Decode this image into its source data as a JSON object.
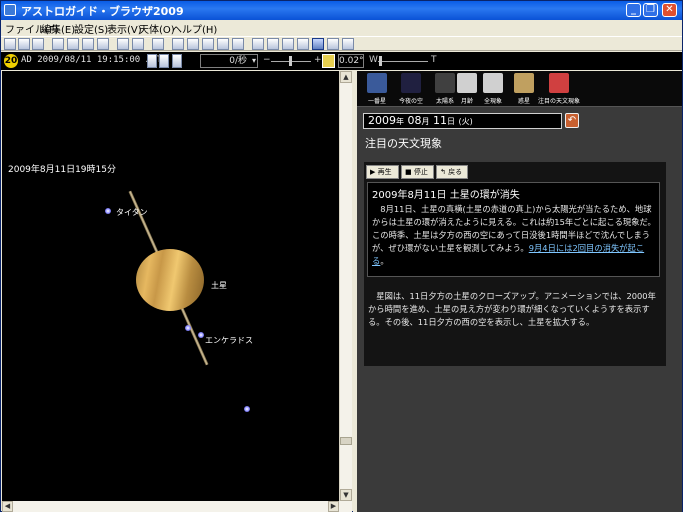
{
  "window": {
    "title": "アストロガイド・ブラウザ2009",
    "controls": [
      "_",
      "❐",
      "✕"
    ]
  },
  "menu": [
    "ファイル(F)",
    "編集(E)",
    "設定(S)",
    "表示(V)",
    "天体(O)",
    "ヘルプ(H)"
  ],
  "statusbar": {
    "badge": "20",
    "era": "AD",
    "datetime": "2009/08/11 19:15:00 JST",
    "speed": "0/秒",
    "minus": "−",
    "plus": "+",
    "zoom": "0.02°",
    "w_label": "W",
    "t_label": "T"
  },
  "sky": {
    "timestamp": "2009年8月11日19時15分",
    "labels": {
      "titan": "タイタン",
      "saturn": "土星",
      "enceladus": "エンケラドス"
    }
  },
  "panel": {
    "buttons": [
      {
        "label": "一番星",
        "color": "#3a5a9a",
        "icon": "star-icon"
      },
      {
        "label": "今夜の空",
        "color": "#202040",
        "icon": "night-sky-icon"
      },
      {
        "label": "太陽系",
        "color": "#404040",
        "icon": "solar-system-icon"
      },
      {
        "label": "月齢",
        "color": "#d0d0d0",
        "icon": "moon-calendar-icon"
      },
      {
        "label": "全現象",
        "color": "#d0d0d0",
        "icon": "calendar-icon"
      },
      {
        "label": "惑星",
        "color": "#c0a060",
        "icon": "planet-book-icon"
      },
      {
        "label": "注目の天文現象",
        "color": "#d04040",
        "icon": "alert-icon"
      }
    ],
    "date": {
      "year": "2009",
      "year_unit": "年",
      "month": "08",
      "month_unit": "月",
      "day": "11",
      "day_unit": "日",
      "weekday": "(火)"
    },
    "section_title": "注目の天文現象",
    "controls": {
      "play": "▶ 再生",
      "stop": "■ 停止",
      "back": "↰ 戻る"
    },
    "article": {
      "title": "2009年8月11日 土星の環が消失",
      "body": "8月11日、土星の真横(土星の赤道の真上)から太陽光が当たるため、地球からは土星の環が消えたように見える。これは約15年ごとに起こる現象だ。この時季、土星は夕方の西の空にあって日没後1時間半ほどで沈んでしまうが、ぜひ環がない土星を観測してみよう。",
      "link": "9月4日には2回目の消失が起こる",
      "period": "。"
    },
    "description": "星図は、11日夕方の土星のクローズアップ。アニメーションでは、2000年から時間を進め、土星の見え方が変わり環が細くなっていくようすを表示する。その後、11日夕方の西の空を表示し、土星を拡大する。"
  }
}
